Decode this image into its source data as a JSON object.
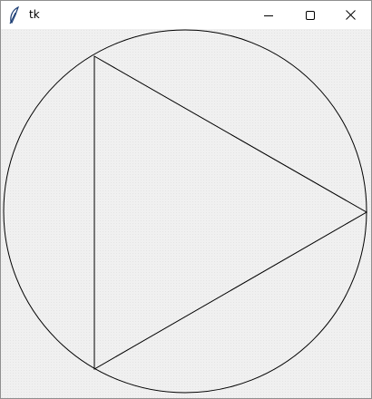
{
  "window": {
    "title": "tk",
    "app_icon": "feather-icon",
    "controls": {
      "minimize_icon": "minimize-icon",
      "maximize_icon": "maximize-icon",
      "close_icon": "close-icon"
    }
  },
  "canvas": {
    "background": "#f0f0f0",
    "stroke_color": "#000000",
    "shapes": [
      "circle",
      "triangle"
    ]
  }
}
